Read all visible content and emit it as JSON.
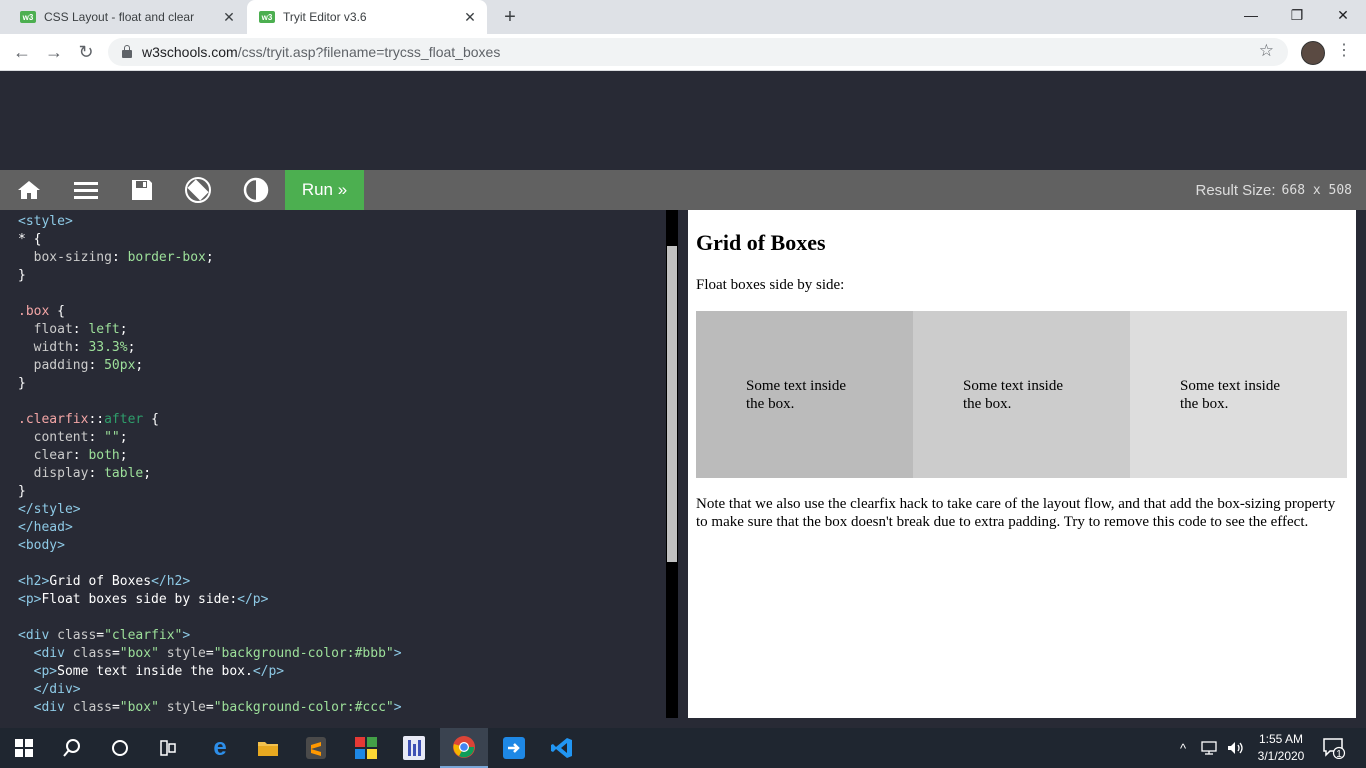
{
  "browser": {
    "tabs": [
      {
        "favicon": "w3",
        "title": "CSS Layout - float and clear",
        "close": "✕"
      },
      {
        "favicon": "w3",
        "title": "Tryit Editor v3.6",
        "close": "✕"
      }
    ],
    "new_tab": "+",
    "window_controls": {
      "minimize": "—",
      "maximize": "❐",
      "close": "✕"
    },
    "url_host": "w3schools.com",
    "url_rest": "/css/tryit.asp?filename=trycss_float_boxes"
  },
  "tryit": {
    "run_label": "Run »",
    "result_size_label": "Result Size:",
    "result_size_value": "668 x 508"
  },
  "result": {
    "heading": "Grid of Boxes",
    "intro": "Float boxes side by side:",
    "boxes": [
      {
        "text": "Some text inside the box.",
        "color": "#bbb"
      },
      {
        "text": "Some text inside the box.",
        "color": "#ccc"
      },
      {
        "text": "Some text inside the box.",
        "color": "#ddd"
      }
    ],
    "note": "Note that we also use the clearfix hack to take care of the layout flow, and that add the box-sizing property to make sure that the box doesn't break due to extra padding. Try to remove this code to see the effect."
  },
  "taskbar": {
    "time": "1:55 AM",
    "date": "3/1/2020",
    "notification_count": "1",
    "icons": [
      "windows-start-icon",
      "search-icon",
      "cortana-icon",
      "task-view-icon",
      "edge-icon",
      "file-explorer-icon",
      "sublime-text-icon",
      "app-grid-icon",
      "paint-icon",
      "chrome-icon",
      "remote-icon",
      "vscode-icon"
    ]
  },
  "colors": {
    "run_green": "#4caf50",
    "editor_bg": "#282a35",
    "tryit_bar": "#616161"
  }
}
